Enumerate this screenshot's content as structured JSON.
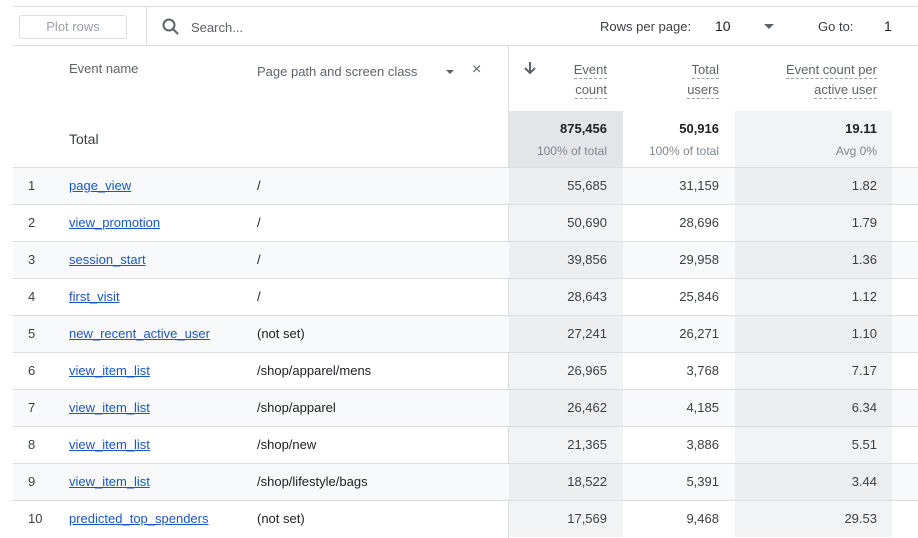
{
  "toolbar": {
    "plot_rows_label": "Plot rows",
    "search_placeholder": "Search...",
    "rows_per_page_label": "Rows per page:",
    "rows_per_page_value": "10",
    "goto_label": "Go to:",
    "goto_value": "1"
  },
  "headers": {
    "event_name": "Event name",
    "dimension": "Page path and screen class",
    "metrics": [
      {
        "line1": "Event",
        "line2": "count",
        "sorted": true
      },
      {
        "line1": "Total",
        "line2": "users"
      },
      {
        "line1": "Event count per",
        "line2": "active user"
      }
    ]
  },
  "totals": {
    "label": "Total",
    "event_count": "875,456",
    "event_count_sub": "100% of total",
    "total_users": "50,916",
    "total_users_sub": "100% of total",
    "ecpu": "19.11",
    "ecpu_sub": "Avg 0%"
  },
  "rows": [
    {
      "idx": "1",
      "name": "page_view",
      "path": "/",
      "event_count": "55,685",
      "total_users": "31,159",
      "ecpu": "1.82"
    },
    {
      "idx": "2",
      "name": "view_promotion",
      "path": "/",
      "event_count": "50,690",
      "total_users": "28,696",
      "ecpu": "1.79"
    },
    {
      "idx": "3",
      "name": "session_start",
      "path": "/",
      "event_count": "39,856",
      "total_users": "29,958",
      "ecpu": "1.36"
    },
    {
      "idx": "4",
      "name": "first_visit",
      "path": "/",
      "event_count": "28,643",
      "total_users": "25,846",
      "ecpu": "1.12"
    },
    {
      "idx": "5",
      "name": "new_recent_active_user",
      "path": "(not set)",
      "event_count": "27,241",
      "total_users": "26,271",
      "ecpu": "1.10"
    },
    {
      "idx": "6",
      "name": "view_item_list",
      "path": "/shop/apparel/mens",
      "event_count": "26,965",
      "total_users": "3,768",
      "ecpu": "7.17"
    },
    {
      "idx": "7",
      "name": "view_item_list",
      "path": "/shop/apparel",
      "event_count": "26,462",
      "total_users": "4,185",
      "ecpu": "6.34"
    },
    {
      "idx": "8",
      "name": "view_item_list",
      "path": "/shop/new",
      "event_count": "21,365",
      "total_users": "3,886",
      "ecpu": "5.51"
    },
    {
      "idx": "9",
      "name": "view_item_list",
      "path": "/shop/lifestyle/bags",
      "event_count": "18,522",
      "total_users": "5,391",
      "ecpu": "3.44"
    },
    {
      "idx": "10",
      "name": "predicted_top_spenders",
      "path": "(not set)",
      "event_count": "17,569",
      "total_users": "9,468",
      "ecpu": "29.53"
    }
  ],
  "colors": {
    "link": "#1a56c8",
    "border": "#dadce0",
    "header_text": "#5f6368"
  }
}
